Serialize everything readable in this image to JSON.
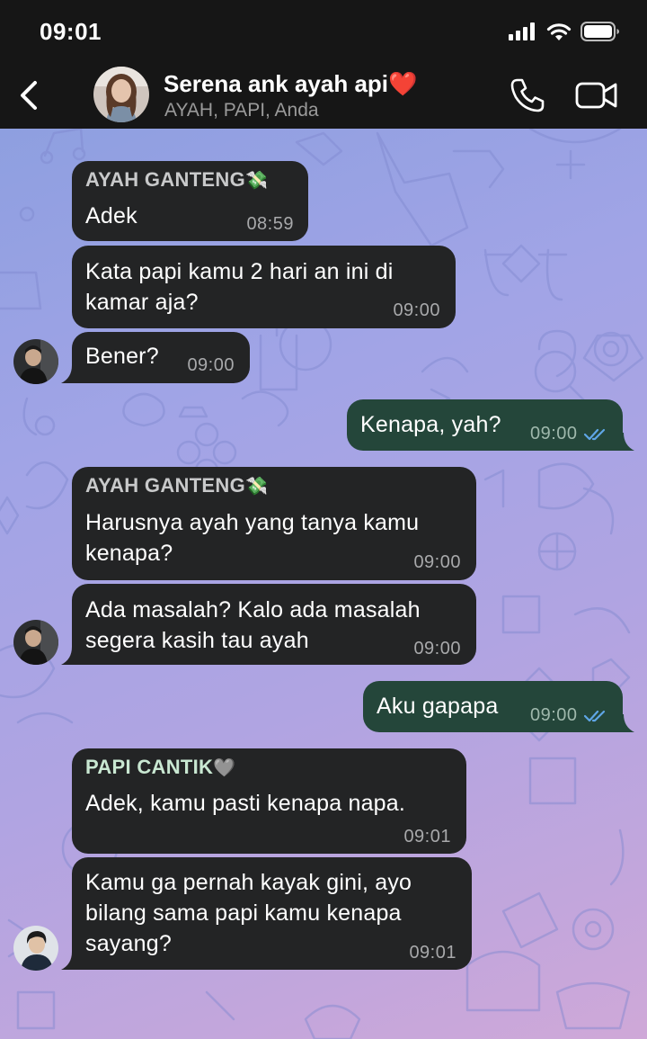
{
  "status": {
    "time": "09:01"
  },
  "header": {
    "title": "Serena ank ayah api",
    "title_emoji": "❤️",
    "subtitle": "AYAH, PAPI, Anda",
    "icons": {
      "back": "chevron-left-icon",
      "call": "phone-icon",
      "video": "video-camera-icon"
    }
  },
  "messages": [
    {
      "sender": "AYAH GANTENG",
      "sender_emoji": "💸",
      "text": "Adek",
      "time": "08:59"
    },
    {
      "text_lines": [
        "Kata papi kamu 2 hari an ini di",
        "kamar aja?"
      ],
      "time": "09:00"
    },
    {
      "text": "Bener?",
      "time": "09:00"
    },
    {
      "text": "Kenapa, yah?",
      "time": "09:00",
      "outgoing": true
    },
    {
      "sender": "AYAH GANTENG",
      "sender_emoji": "💸",
      "text_lines": [
        "Harusnya ayah yang tanya kamu",
        "kenapa?"
      ],
      "time": "09:00"
    },
    {
      "text_lines": [
        "Ada masalah? Kalo ada masalah",
        "segera kasih tau ayah"
      ],
      "time": "09:00"
    },
    {
      "text": "Aku gapapa",
      "time": "09:00",
      "outgoing": true
    },
    {
      "sender": "PAPI CANTIK",
      "sender_emoji": "🩶",
      "text": "Adek, kamu pasti kenapa napa.",
      "time": "09:01"
    },
    {
      "text_lines": [
        "Kamu ga pernah kayak gini, ayo",
        "bilang sama papi kamu kenapa",
        "sayang?"
      ],
      "time": "09:01"
    }
  ],
  "colors": {
    "incoming_bubble": "#232425",
    "outgoing_bubble": "#24463a",
    "read_ticks": "#5fa6e6",
    "header_bg": "#161616"
  }
}
